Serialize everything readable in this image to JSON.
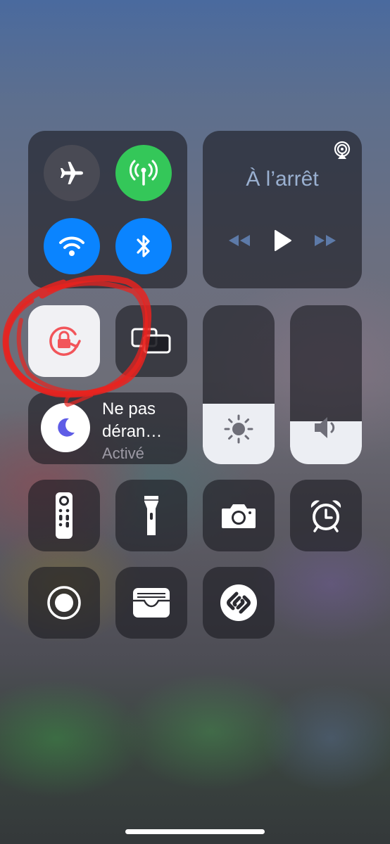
{
  "connectivity": {
    "airplane_mode": {
      "icon": "airplane-icon",
      "state": "off"
    },
    "cellular_data": {
      "icon": "antenna-icon",
      "state": "on",
      "color": "#34c759"
    },
    "wifi": {
      "icon": "wifi-icon",
      "state": "on",
      "color": "#0a84ff"
    },
    "bluetooth": {
      "icon": "bluetooth-icon",
      "state": "on",
      "color": "#0a84ff"
    }
  },
  "media": {
    "status": "À l’arrêt",
    "airplay_icon": "airplay-icon",
    "controls": [
      "backward-icon",
      "play-icon",
      "forward-icon"
    ]
  },
  "orientation_lock": {
    "icon": "orientation-lock-icon",
    "state": "on",
    "color": "#f2555a"
  },
  "screen_mirroring": {
    "icon": "screen-mirroring-icon"
  },
  "do_not_disturb": {
    "title_line1": "Ne pas",
    "title_line2": "déran…",
    "status": "Activé",
    "icon": "moon-icon",
    "icon_color": "#5e5ce6"
  },
  "brightness": {
    "icon": "sun-icon",
    "level": 0.38
  },
  "volume": {
    "icon": "speaker-icon",
    "level": 0.27
  },
  "shortcuts": [
    {
      "name": "apple-tv-remote",
      "icon": "remote-icon"
    },
    {
      "name": "flashlight",
      "icon": "flashlight-icon"
    },
    {
      "name": "camera",
      "icon": "camera-icon"
    },
    {
      "name": "alarm",
      "icon": "alarm-clock-icon"
    },
    {
      "name": "screen-recording",
      "icon": "record-icon"
    },
    {
      "name": "wallet",
      "icon": "wallet-icon"
    },
    {
      "name": "shazam",
      "icon": "shazam-icon"
    }
  ],
  "annotation": {
    "shape": "red-scribble-circle",
    "color": "#e8231f"
  }
}
